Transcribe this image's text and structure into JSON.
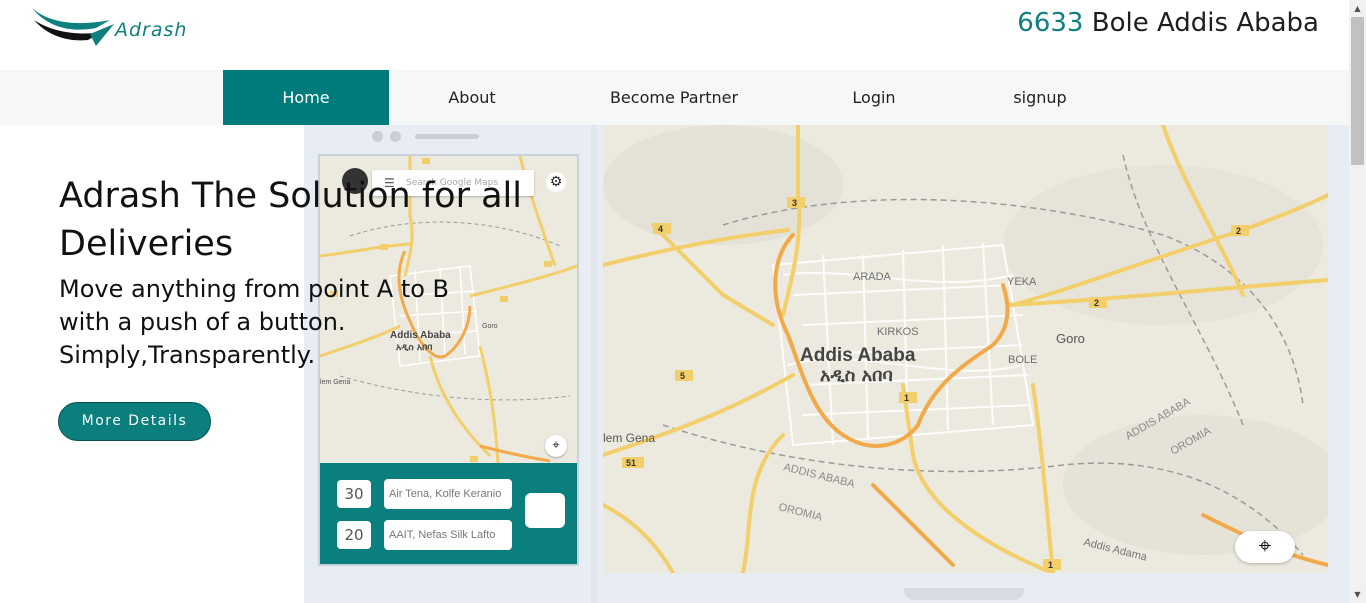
{
  "brand": {
    "name": "Adrash"
  },
  "header": {
    "address_number": "6633",
    "address_text": " Bole Addis Ababa"
  },
  "nav": [
    {
      "label": "Home",
      "active": true
    },
    {
      "label": "About"
    },
    {
      "label": "Become Partner"
    },
    {
      "label": "Login"
    },
    {
      "label": "signup"
    }
  ],
  "hero": {
    "title": "Adrash The Solution for all Deliveries",
    "subtitle_line1": "Move anything from point A to B",
    "subtitle_line2": "with a push of a button.",
    "subtitle_line3": "Simply,Transparently.",
    "cta_label": "More Details"
  },
  "phone": {
    "search_placeholder": "Search Google Maps",
    "map_labels": [
      "Addis Ababa",
      "አዲስ አበባ",
      "Goro",
      "lem Gena"
    ],
    "trips": [
      {
        "eta": "30",
        "place": "Air Tena, Kolfe Keranio"
      },
      {
        "eta": "20",
        "place": "AAIT, Nefas Silk Lafto"
      }
    ]
  },
  "big_map": {
    "city": "Addis Ababa",
    "city_amharic": "አዲስ አበባ",
    "labels": [
      "ARADA",
      "YEKA",
      "KIRKOS",
      "BOLE",
      "Goro",
      "lem Gena",
      "ADDIS ABABA",
      "OROMIA",
      "ADDIS ABABA",
      "OROMIA",
      "Addis Adama"
    ],
    "road_numbers": [
      "3",
      "4",
      "2",
      "2",
      "5",
      "1",
      "51",
      "1"
    ]
  },
  "colors": {
    "teal": "#007b7b",
    "nav_bg": "#f6f7f9",
    "device": "#e8ecf3"
  }
}
